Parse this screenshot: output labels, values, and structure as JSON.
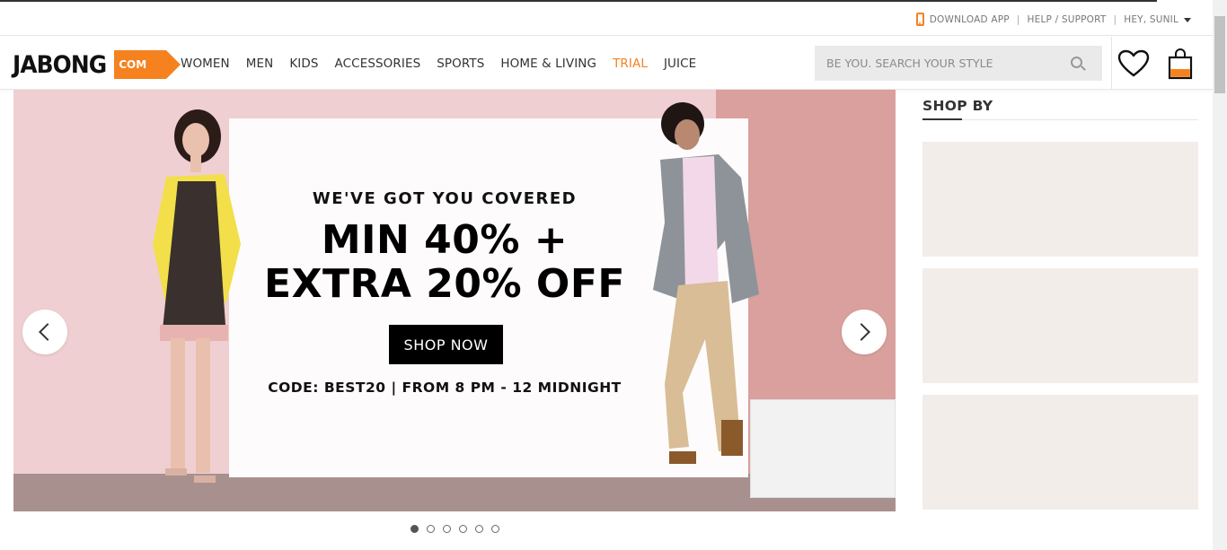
{
  "utility_bar": {
    "download_app": "DOWNLOAD APP",
    "separator": "|",
    "help_support": "HELP / SUPPORT",
    "greeting": "HEY, SUNIL"
  },
  "header": {
    "logo_text": "JABONG",
    "logo_tag": "COM",
    "nav": [
      "WOMEN",
      "MEN",
      "KIDS",
      "ACCESSORIES",
      "SPORTS",
      "HOME & LIVING",
      "TRIAL",
      "JUICE"
    ],
    "search_placeholder": "BE YOU. SEARCH YOUR STYLE",
    "accent_color": "#f5821f"
  },
  "banner": {
    "tagline": "WE'VE GOT YOU COVERED",
    "headline_line1": "MIN 40% +",
    "headline_line2": "EXTRA 20% OFF",
    "cta": "SHOP NOW",
    "code_text": "CODE: BEST20 | FROM 8 PM - 12 MIDNIGHT",
    "slides_count": 6,
    "active_slide": 1
  },
  "shop_by": {
    "title": "SHOP BY"
  }
}
